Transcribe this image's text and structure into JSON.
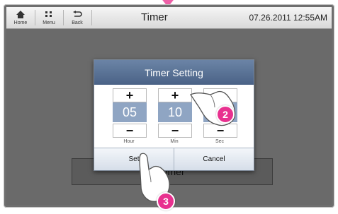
{
  "nav": {
    "home_label": "Home",
    "menu_label": "Menu",
    "back_label": "Back"
  },
  "header": {
    "title": "Timer",
    "datetime": "07.26.2011 12:55AM"
  },
  "background_button": {
    "label": "Timer"
  },
  "dialog": {
    "title": "Timer Setting",
    "spinners": [
      {
        "label": "Hour",
        "value": "05",
        "plus": "+",
        "minus": "−"
      },
      {
        "label": "Min",
        "value": "10",
        "plus": "+",
        "minus": "−"
      },
      {
        "label": "Sec",
        "value": "",
        "plus": "+",
        "minus": "−"
      }
    ],
    "set_label": "Set",
    "cancel_label": "Cancel"
  },
  "markers": [
    "2",
    "3"
  ],
  "colors": {
    "accent_pink": "#e8318f",
    "title_blue": "#4a6286",
    "value_blue": "#8fa5c3"
  }
}
